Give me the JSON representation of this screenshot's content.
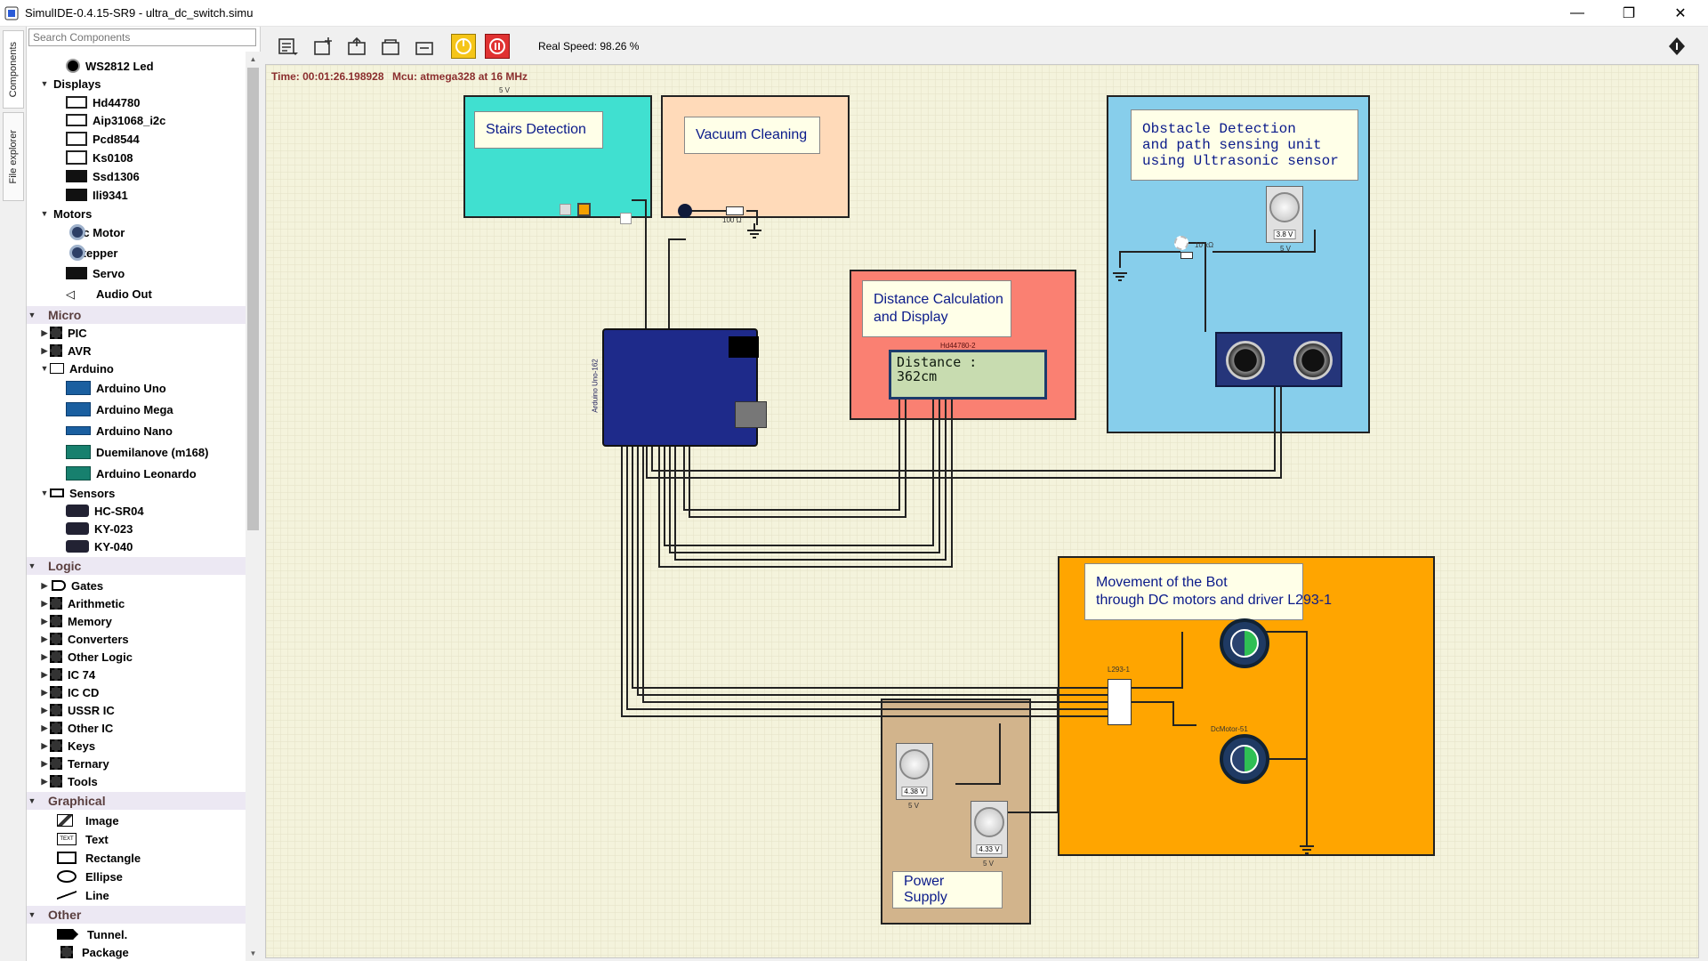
{
  "window": {
    "title": "SimulIDE-0.4.15-SR9  -  ultra_dc_switch.simu",
    "minimize": "—",
    "restore": "❐",
    "close": "✕"
  },
  "side_tabs": {
    "components": "Components",
    "file_explorer": "File explorer"
  },
  "search": {
    "placeholder": "Search Components"
  },
  "tree": {
    "ws2812": "WS2812 Led",
    "displays": "Displays",
    "hd44780": "Hd44780",
    "aip31068": "Aip31068_i2c",
    "pcd8544": "Pcd8544",
    "ks0108": "Ks0108",
    "ssd1306": "Ssd1306",
    "ili9341": "Ili9341",
    "motors": "Motors",
    "dc_motor": "Dc Motor",
    "stepper": "Stepper",
    "servo": "Servo",
    "audio_out": "Audio Out",
    "micro": "Micro",
    "pic": "PIC",
    "avr": "AVR",
    "arduino": "Arduino",
    "arduino_uno": "Arduino Uno",
    "arduino_mega": "Arduino Mega",
    "arduino_nano": "Arduino Nano",
    "duemilanove": "Duemilanove (m168)",
    "leonardo": "Arduino Leonardo",
    "sensors": "Sensors",
    "hcsr04": "HC-SR04",
    "ky023": "KY-023",
    "ky040": "KY-040",
    "logic": "Logic",
    "gates": "Gates",
    "arithmetic": "Arithmetic",
    "memory": "Memory",
    "converters": "Converters",
    "other_logic": "Other Logic",
    "ic74": "IC 74",
    "iccd": "IC CD",
    "ussr": "USSR IC",
    "other_ic": "Other IC",
    "keys": "Keys",
    "ternary": "Ternary",
    "tools": "Tools",
    "graphical": "Graphical",
    "image": "Image",
    "text": "Text",
    "rectangle": "Rectangle",
    "ellipse": "Ellipse",
    "line": "Line",
    "other": "Other",
    "tunnel": "Tunnel.",
    "package": "Package"
  },
  "toolbar": {
    "real_speed": "Real Speed: 98.26 %"
  },
  "canvas": {
    "time": "Time: 00:01:26.198928",
    "mcu": "Mcu: atmega328 at 16 MHz",
    "stairs_label": "Stairs Detection",
    "vacuum_label": "Vacuum Cleaning",
    "distance_label": "Distance Calculation\nand Display",
    "lcd_name": "Hd44780-2",
    "lcd_text": "Distance :\n362cm",
    "obstacle_label": "Obstacle Detection\nand path sensing unit\nusing Ultrasonic sensor",
    "movement_label": "Movement of the Bot\nthrough DC motors and driver L293-1",
    "power_label": "Power Supply",
    "pot1_value": "3.8 V",
    "pot2_value": "4.38 V",
    "pot3_value": "4.33 V",
    "five_v": "5 V",
    "res_100": "100 Ω",
    "res_10k": "10 kΩ",
    "l293_name": "L293-1",
    "dcmotor_name": "DcMotor-51",
    "arduino_name": "Arduino Uno-162"
  },
  "colors": {
    "stairs_bg": "#40e0d0",
    "vacuum_bg": "#ffdab9",
    "distance_bg": "#fa8072",
    "obstacle_bg": "#87ceeb",
    "movement_bg": "#ffa500",
    "power_bg": "#d2b48c",
    "arduino": "#1e2a8a",
    "canvas_bg": "#f4f3dc",
    "grid": "#e4e2c6"
  }
}
